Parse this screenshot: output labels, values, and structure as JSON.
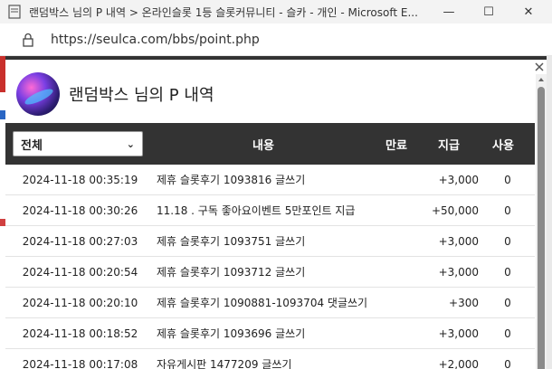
{
  "window": {
    "title": "랜덤박스 님의 P 내역 > 온라인슬롯 1등 슬롯커뮤니티 - 슬카 - 개인 - Microsoft E...",
    "minimize_glyph": "—",
    "maximize_glyph": "☐",
    "close_glyph": "✕"
  },
  "address": {
    "url": "https://seulca.com/bbs/point.php"
  },
  "popup": {
    "title": "랜덤박스 님의 P 내역"
  },
  "table": {
    "filter_value": "전체",
    "headers": {
      "content": "내용",
      "expire": "만료",
      "give": "지급",
      "use": "사용"
    },
    "rows": [
      {
        "date": "2024-11-18 00:35:19",
        "content": "제휴 슬롯후기 1093816 글쓰기",
        "expire": "",
        "give": "+3,000",
        "use": "0"
      },
      {
        "date": "2024-11-18 00:30:26",
        "content": "11.18 . 구독 좋아요이벤트 5만포인트 지급",
        "expire": "",
        "give": "+50,000",
        "use": "0"
      },
      {
        "date": "2024-11-18 00:27:03",
        "content": "제휴 슬롯후기 1093751 글쓰기",
        "expire": "",
        "give": "+3,000",
        "use": "0"
      },
      {
        "date": "2024-11-18 00:20:54",
        "content": "제휴 슬롯후기 1093712 글쓰기",
        "expire": "",
        "give": "+3,000",
        "use": "0"
      },
      {
        "date": "2024-11-18 00:20:10",
        "content": "제휴 슬롯후기 1090881-1093704 댓글쓰기",
        "expire": "",
        "give": "+300",
        "use": "0"
      },
      {
        "date": "2024-11-18 00:18:52",
        "content": "제휴 슬롯후기 1093696 글쓰기",
        "expire": "",
        "give": "+3,000",
        "use": "0"
      },
      {
        "date": "2024-11-18 00:17:08",
        "content": "자유게시판 1477209 글쓰기",
        "expire": "",
        "give": "+2,000",
        "use": "0"
      }
    ]
  },
  "icons": {
    "app": "edge-page-icon",
    "lock": "lock-icon",
    "close_popup": "close-icon"
  }
}
